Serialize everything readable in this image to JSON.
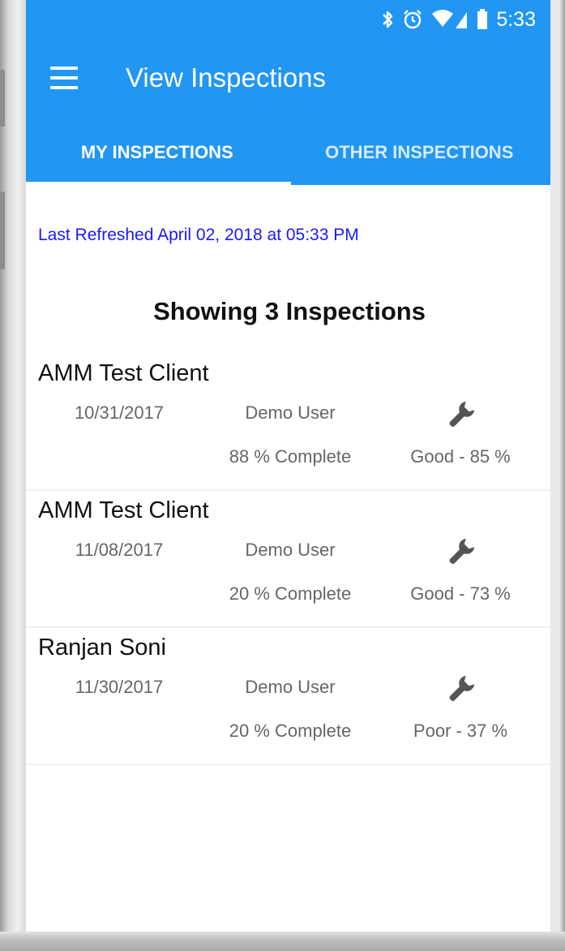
{
  "status_bar": {
    "time": "5:33"
  },
  "app_bar": {
    "title": "View Inspections"
  },
  "tabs": [
    {
      "label": "MY INSPECTIONS",
      "active": true
    },
    {
      "label": "OTHER INSPECTIONS",
      "active": false
    }
  ],
  "last_refreshed": "Last Refreshed April 02, 2018 at 05:33 PM",
  "count_label": "Showing 3 Inspections",
  "inspections": [
    {
      "client": "AMM Test Client",
      "date": "10/31/2017",
      "user": "Demo User",
      "complete": "88 % Complete",
      "rating": "Good - 85 %"
    },
    {
      "client": "AMM Test Client",
      "date": "11/08/2017",
      "user": "Demo User",
      "complete": "20 % Complete",
      "rating": "Good - 73 %"
    },
    {
      "client": "Ranjan Soni",
      "date": "11/30/2017",
      "user": "Demo User",
      "complete": "20 % Complete",
      "rating": "Poor - 37 %"
    }
  ],
  "colors": {
    "primary": "#2196f3",
    "link": "#1a1aff",
    "secondary_text": "#666666"
  },
  "icons": {
    "menu": "menu-icon",
    "inspection": "wrench-icon"
  }
}
